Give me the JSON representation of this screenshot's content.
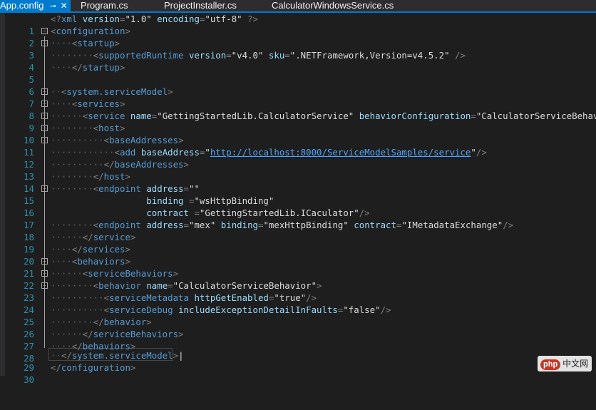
{
  "tabs": [
    {
      "label": "App.config",
      "active": true,
      "pin_icon": "pin-icon",
      "close_icon": "close-icon"
    },
    {
      "label": "Program.cs",
      "active": false
    },
    {
      "label": "ProjectInstaller.cs",
      "active": false
    },
    {
      "label": "CalculatorWindowsService.cs",
      "active": false
    }
  ],
  "lines": [
    {
      "n": "1"
    },
    {
      "n": "2"
    },
    {
      "n": "3"
    },
    {
      "n": "4"
    },
    {
      "n": "5"
    },
    {
      "n": "6"
    },
    {
      "n": "7"
    },
    {
      "n": "8"
    },
    {
      "n": "9"
    },
    {
      "n": "10"
    },
    {
      "n": "11"
    },
    {
      "n": "12"
    },
    {
      "n": "13"
    },
    {
      "n": "14"
    },
    {
      "n": "15"
    },
    {
      "n": "16"
    },
    {
      "n": "17"
    },
    {
      "n": "18"
    },
    {
      "n": "19"
    },
    {
      "n": "20"
    },
    {
      "n": "21"
    },
    {
      "n": "22"
    },
    {
      "n": "23"
    },
    {
      "n": "24"
    },
    {
      "n": "25"
    },
    {
      "n": "26"
    },
    {
      "n": "27"
    },
    {
      "n": "28"
    },
    {
      "n": "29"
    },
    {
      "n": "30"
    }
  ],
  "code": {
    "xml_decl": [
      "xml",
      "version",
      "\"1.0\"",
      "encoding",
      "\"utf-8\""
    ],
    "configuration": "configuration",
    "startup": "startup",
    "supportedRuntime": "supportedRuntime",
    "version_attr": "version",
    "version_val": "\"v4.0\"",
    "sku_attr": "sku",
    "sku_val": "\".NETFramework,Version=v4.5.2\"",
    "serviceModel": "system.serviceModel",
    "services": "services",
    "service": "service",
    "name_attr": "name",
    "service_name_val": "\"GettingStartedLib.CalculatorService\"",
    "behaviorConfiguration_attr": "behaviorConfiguration",
    "behaviorConfiguration_val": "\"CalculatorServiceBehavior\"",
    "host": "host",
    "baseAddresses": "baseAddresses",
    "add": "add",
    "baseAddress_attr": "baseAddress",
    "baseAddress_url": "http://localhost:8000/ServiceModelSamples/service",
    "endpoint": "endpoint",
    "address_attr": "address",
    "address_empty": "\"\"",
    "binding_attr": "binding",
    "binding_val": "\"wsHttpBinding\"",
    "contract_attr": "contract",
    "contract_val": "\"GettingStartedLib.ICaculator\"",
    "address_mex": "\"mex\"",
    "binding_mex": "\"mexHttpBinding\"",
    "contract_mex": "\"IMetadataExchange\"",
    "behaviors": "behaviors",
    "serviceBehaviors": "serviceBehaviors",
    "behavior": "behavior",
    "behavior_name_val": "\"CalculatorServiceBehavior\"",
    "serviceMetadata": "serviceMetadata",
    "httpGetEnabled_attr": "httpGetEnabled",
    "true_val": "\"true\"",
    "serviceDebug": "serviceDebug",
    "includeException_attr": "includeExceptionDetailInFaults",
    "false_val": "\"false\""
  },
  "watermark": {
    "logo": "php",
    "text": "中文网"
  }
}
